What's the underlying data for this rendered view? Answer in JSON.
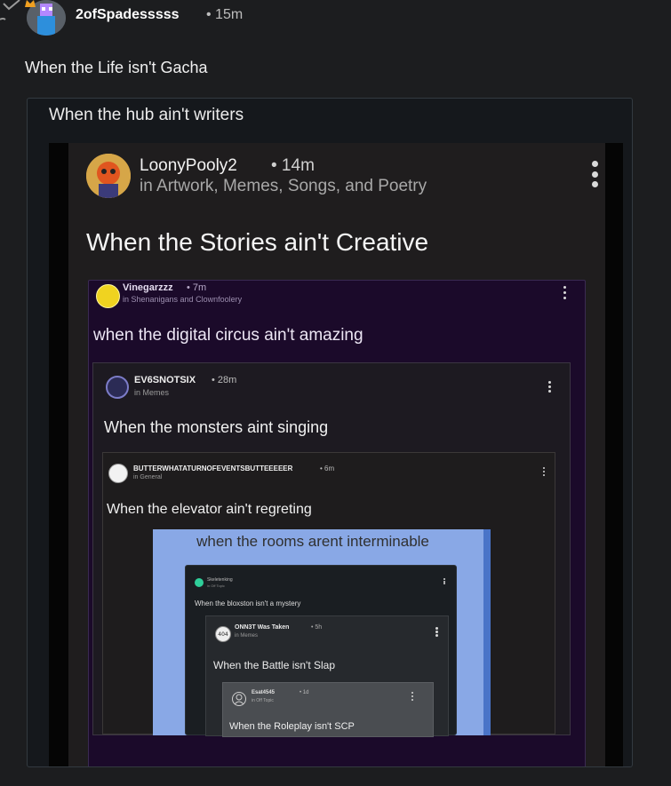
{
  "post": {
    "username": "2ofSpadesssss",
    "time": "• 15m",
    "body": "When the Life isn't Gacha"
  },
  "quote": {
    "text": "When the hub ain't writers",
    "screenshot": {
      "author": "LoonyPooly2",
      "time": "• 14m",
      "location": "in Artwork, Memes, Songs, and Poetry",
      "title": "When the Stories ain't Creative",
      "nested": {
        "author": "Vinegarzzz",
        "time": "• 7m",
        "location": "in Shenanigans and Clownfoolery",
        "body": "when the digital circus ain't amazing",
        "nested": {
          "author": "EV6SNOTSIX",
          "time": "• 28m",
          "location": "in Memes",
          "body": "When the monsters aint singing",
          "nested": {
            "author": "BUTTERWHATATURNOFEVENTSBUTTEEEEER",
            "time": "• 6m",
            "location": "in General",
            "body": "When the elevator ain't regreting",
            "image": {
              "caption": "when the rooms arent interminable",
              "nested": {
                "author": "Skeletenking",
                "time": "• 1d",
                "location": "in Off Topic",
                "body": "When the bloxston isn't a mystery",
                "nested": {
                  "author": "ONN3T Was Taken",
                  "time": "• 5h",
                  "location": "in Memes",
                  "avatar_text": "404",
                  "body": "When the Battle isn't Slap",
                  "nested": {
                    "author": "Esat4545",
                    "time": "• 1d",
                    "location": "in Off Topic",
                    "body": "When the Roleplay isn't SCP"
                  }
                }
              }
            }
          }
        }
      },
      "video_progress": 0.08
    }
  },
  "colors": {
    "background": "#1c1d1f",
    "quote_bg": "#15181c",
    "purple_card": "#1b0a2a",
    "rooms_blue": "#89a8e6"
  },
  "icons": [
    "avatar",
    "kebab-menu-icon",
    "check-icon"
  ]
}
